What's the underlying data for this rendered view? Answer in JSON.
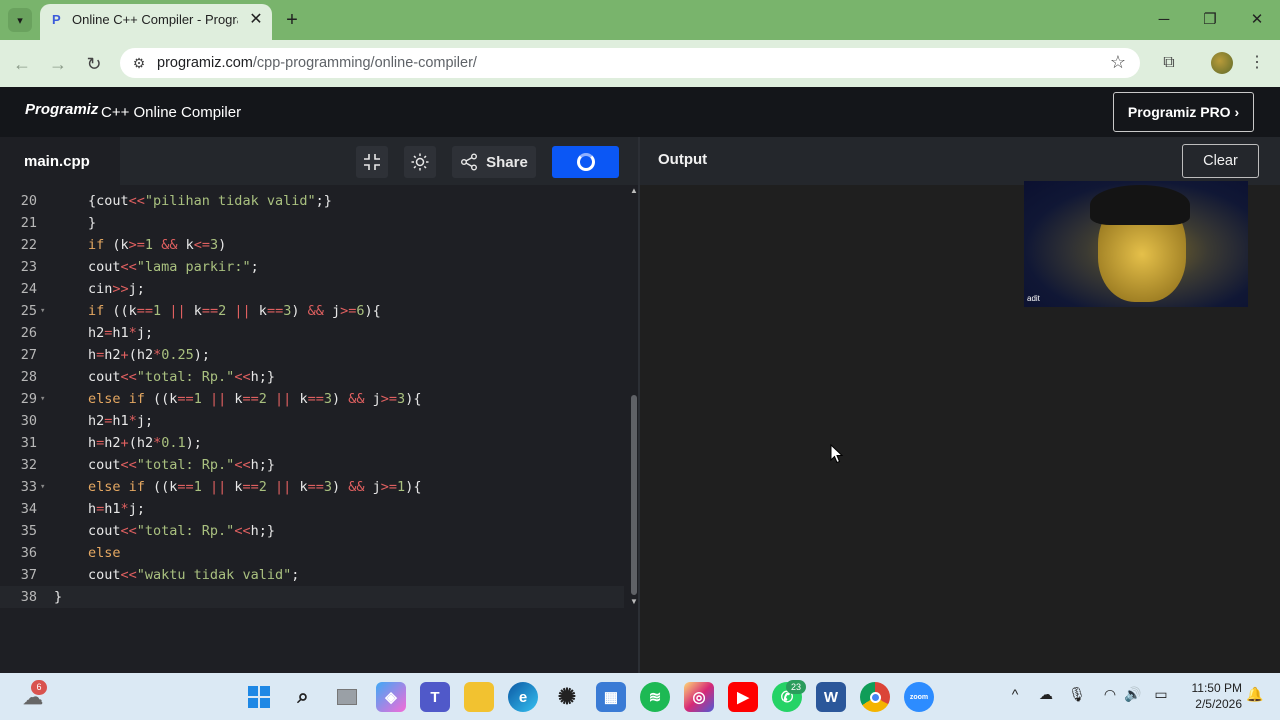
{
  "browser": {
    "tab_title": "Online C++ Compiler - Programiz",
    "url_host": "programiz.com",
    "url_path": "/cpp-programming/online-compiler/",
    "icons": [
      "tab-search-icon",
      "close-icon",
      "new-tab-icon",
      "minimize-icon",
      "maximize-icon",
      "window-close-icon",
      "back-icon",
      "forward-icon",
      "reload-icon",
      "site-info-icon",
      "bookmark-star-icon",
      "extensions-icon",
      "profile-icon",
      "menu-icon"
    ]
  },
  "header": {
    "logo": "Programiz",
    "title": "C++ Online Compiler",
    "pro_button": "Programiz PRO ›"
  },
  "editor": {
    "file_tab": "main.cpp",
    "share_label": "Share",
    "lines": [
      {
        "n": "20",
        "fold": false,
        "html": "{cout<span class='op'>&lt;&lt;</span><span class='st'>\"pilihan tidak valid\"</span>;}"
      },
      {
        "n": "21",
        "fold": false,
        "html": "}"
      },
      {
        "n": "22",
        "fold": false,
        "html": "<span class='kw'>if</span> (k<span class='op'>&gt;=</span><span class='st'>1</span> <span class='op'>&amp;&amp;</span> k<span class='op'>&lt;=</span><span class='st'>3</span>)"
      },
      {
        "n": "23",
        "fold": false,
        "html": "cout<span class='op'>&lt;&lt;</span><span class='st'>\"lama parkir:\"</span>;"
      },
      {
        "n": "24",
        "fold": false,
        "html": "cin<span class='op'>&gt;&gt;</span>j;"
      },
      {
        "n": "25",
        "fold": true,
        "html": "<span class='kw'>if</span> ((k<span class='op'>==</span><span class='st'>1</span> <span class='op'>||</span> k<span class='op'>==</span><span class='st'>2</span> <span class='op'>||</span> k<span class='op'>==</span><span class='st'>3</span>) <span class='op'>&amp;&amp;</span> j<span class='op'>&gt;=</span><span class='st'>6</span>){"
      },
      {
        "n": "26",
        "fold": false,
        "html": "h2<span class='op'>=</span>h1<span class='op'>*</span>j;"
      },
      {
        "n": "27",
        "fold": false,
        "html": "h<span class='op'>=</span>h2<span class='op'>+</span>(h2<span class='op'>*</span><span class='st'>0.25</span>);"
      },
      {
        "n": "28",
        "fold": false,
        "html": "cout<span class='op'>&lt;&lt;</span><span class='st'>\"total: Rp.\"</span><span class='op'>&lt;&lt;</span>h;}"
      },
      {
        "n": "29",
        "fold": true,
        "html": "<span class='kw'>else if</span> ((k<span class='op'>==</span><span class='st'>1</span> <span class='op'>||</span> k<span class='op'>==</span><span class='st'>2</span> <span class='op'>||</span> k<span class='op'>==</span><span class='st'>3</span>) <span class='op'>&amp;&amp;</span> j<span class='op'>&gt;=</span><span class='st'>3</span>){"
      },
      {
        "n": "30",
        "fold": false,
        "html": "h2<span class='op'>=</span>h1<span class='op'>*</span>j;"
      },
      {
        "n": "31",
        "fold": false,
        "html": "h<span class='op'>=</span>h2<span class='op'>+</span>(h2<span class='op'>*</span><span class='st'>0.1</span>);"
      },
      {
        "n": "32",
        "fold": false,
        "html": "cout<span class='op'>&lt;&lt;</span><span class='st'>\"total: Rp.\"</span><span class='op'>&lt;&lt;</span>h;}"
      },
      {
        "n": "33",
        "fold": true,
        "html": "<span class='kw'>else if</span> ((k<span class='op'>==</span><span class='st'>1</span> <span class='op'>||</span> k<span class='op'>==</span><span class='st'>2</span> <span class='op'>||</span> k<span class='op'>==</span><span class='st'>3</span>) <span class='op'>&amp;&amp;</span> j<span class='op'>&gt;=</span><span class='st'>1</span>){"
      },
      {
        "n": "34",
        "fold": false,
        "html": "h<span class='op'>=</span>h1<span class='op'>*</span>j;"
      },
      {
        "n": "35",
        "fold": false,
        "html": "cout<span class='op'>&lt;&lt;</span><span class='st'>\"total: Rp.\"</span><span class='op'>&lt;&lt;</span>h;}"
      },
      {
        "n": "36",
        "fold": false,
        "html": "<span class='kw'>else</span>"
      },
      {
        "n": "37",
        "fold": false,
        "html": "cout<span class='op'>&lt;&lt;</span><span class='st'>\"waktu tidak valid\"</span>;"
      },
      {
        "n": "38",
        "fold": false,
        "html": "}"
      }
    ]
  },
  "output": {
    "label": "Output",
    "clear_label": "Clear"
  },
  "webcam": {
    "name": "adit"
  },
  "taskbar": {
    "apps": [
      "start",
      "search",
      "task-view",
      "copilot",
      "teams",
      "file-explorer",
      "edge",
      "chatgpt",
      "store",
      "spotify",
      "instagram",
      "youtube",
      "whatsapp",
      "word",
      "chrome",
      "zoom"
    ],
    "weather_badge": "6",
    "whatsapp_badge": "23",
    "zoom_label": "zoom",
    "time": "11:50 PM",
    "date": "2/5/2026"
  },
  "colors": {
    "accent": "#0b57f5",
    "tab_bar": "#79b46c",
    "toolbar": "#dfeedd",
    "editor_bg": "#1e1f24"
  }
}
